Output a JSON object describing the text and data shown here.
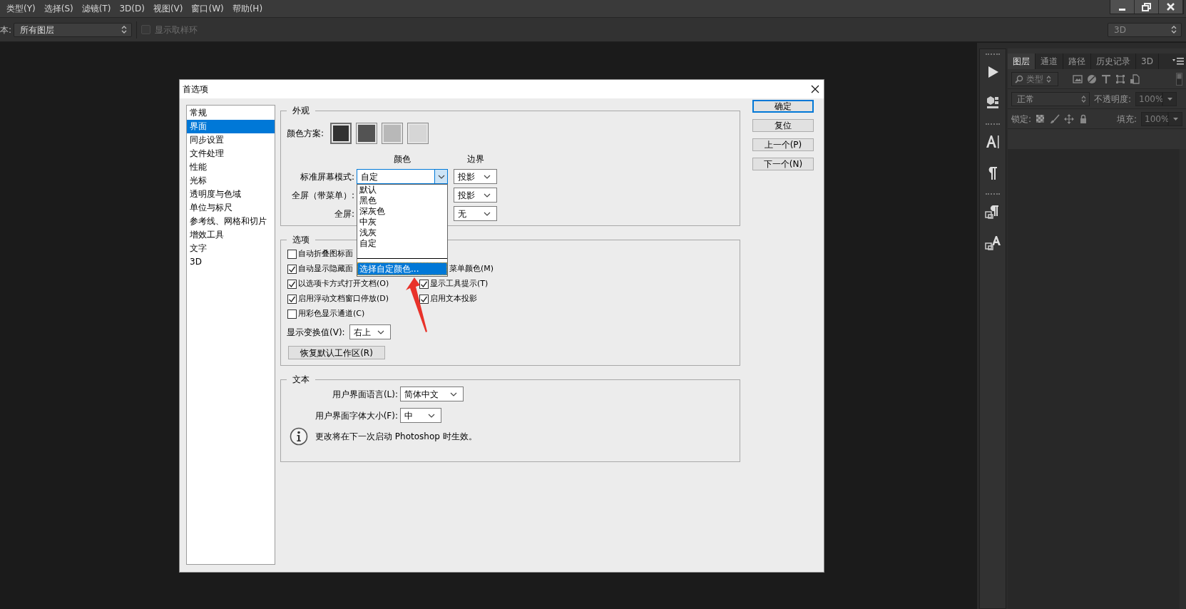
{
  "menu_bar": [
    {
      "label": "类型(Y)"
    },
    {
      "label": "选择(S)"
    },
    {
      "label": "滤镜(T)"
    },
    {
      "label": "3D(D)"
    },
    {
      "label": "视图(V)"
    },
    {
      "label": "窗口(W)"
    },
    {
      "label": "帮助(H)"
    }
  ],
  "options_bar": {
    "sample_label": "本:",
    "sample_select": "所有图层",
    "show_ring": {
      "label": "显示取样环",
      "checked": false,
      "disabled": true
    },
    "workspace": "3D"
  },
  "layers_panel": {
    "tabs": [
      {
        "label": "图层",
        "selected": true
      },
      {
        "label": "通道",
        "selected": false
      },
      {
        "label": "路径",
        "selected": false
      },
      {
        "label": "历史记录",
        "selected": false
      },
      {
        "label": "3D",
        "selected": false
      }
    ],
    "filter": "类型",
    "blend_mode": "正常",
    "opacity_label": "不透明度:",
    "opacity": "100%",
    "lock_label": "锁定:",
    "fill_label": "填充:",
    "fill": "100%"
  },
  "dialog": {
    "title": "首选项",
    "sidebar": [
      {
        "label": "常规",
        "selected": false
      },
      {
        "label": "界面",
        "selected": true
      },
      {
        "label": "同步设置",
        "selected": false
      },
      {
        "label": "文件处理",
        "selected": false
      },
      {
        "label": "性能",
        "selected": false
      },
      {
        "label": "光标",
        "selected": false
      },
      {
        "label": "透明度与色域",
        "selected": false
      },
      {
        "label": "单位与标尺",
        "selected": false
      },
      {
        "label": "参考线、网格和切片",
        "selected": false
      },
      {
        "label": "增效工具",
        "selected": false
      },
      {
        "label": "文字",
        "selected": false
      },
      {
        "label": "3D",
        "selected": false
      }
    ],
    "appearance": {
      "title": "外观",
      "scheme_label": "颜色方案:",
      "swatches": [
        {
          "color": "#323232",
          "selected": true
        },
        {
          "color": "#535353",
          "selected": false
        },
        {
          "color": "#b8b8b8",
          "selected": false
        },
        {
          "color": "#d6d6d6",
          "selected": false
        }
      ],
      "color_header": "颜色",
      "border_header": "边界",
      "rows": [
        {
          "label": "标准屏幕模式:",
          "color_value": "自定",
          "border": "投影"
        },
        {
          "label": "全屏（带菜单）:",
          "border": "投影"
        },
        {
          "label": "全屏:",
          "border": "无"
        }
      ],
      "dropdown": [
        {
          "label": "默认",
          "kind": "option",
          "selected": false
        },
        {
          "label": "黑色",
          "kind": "option",
          "selected": false
        },
        {
          "label": "深灰色",
          "kind": "option",
          "selected": false
        },
        {
          "label": "中灰",
          "kind": "option",
          "selected": false
        },
        {
          "label": "浅灰",
          "kind": "option",
          "selected": false
        },
        {
          "label": "自定",
          "kind": "option",
          "selected": false
        },
        {
          "label": "选择自定颜色...",
          "kind": "action",
          "selected": true
        }
      ]
    },
    "options": {
      "title": "选项",
      "left": [
        {
          "label": "自动折叠图标面",
          "checked": false
        },
        {
          "label": "自动显示隐藏面",
          "checked": true
        },
        {
          "label": "以选项卡方式打开文档(O)",
          "checked": true
        },
        {
          "label": "启用浮动文档窗口停放(D)",
          "checked": true
        },
        {
          "label": "用彩色显示通道(C)",
          "checked": false
        }
      ],
      "right": [
        {
          "label": "菜单颜色(M)",
          "kind": "label"
        },
        {
          "label": "显示工具提示(T)",
          "kind": "checkbox",
          "checked": true
        },
        {
          "label": "启用文本投影",
          "kind": "checkbox",
          "checked": true
        }
      ],
      "transform_label": "显示变换值(V):",
      "transform": "右上",
      "reset_button": "恢复默认工作区(R)"
    },
    "text": {
      "title": "文本",
      "language_label": "用户界面语言(L):",
      "language": "简体中文",
      "font_size_label": "用户界面字体大小(F):",
      "font_size": "中",
      "note": "更改将在下一次启动 Photoshop 时生效。"
    },
    "buttons": [
      {
        "label": "确定",
        "default": true
      },
      {
        "label": "复位",
        "default": false
      },
      {
        "label": "上一个(P)",
        "default": false
      },
      {
        "label": "下一个(N)",
        "default": false
      }
    ]
  }
}
